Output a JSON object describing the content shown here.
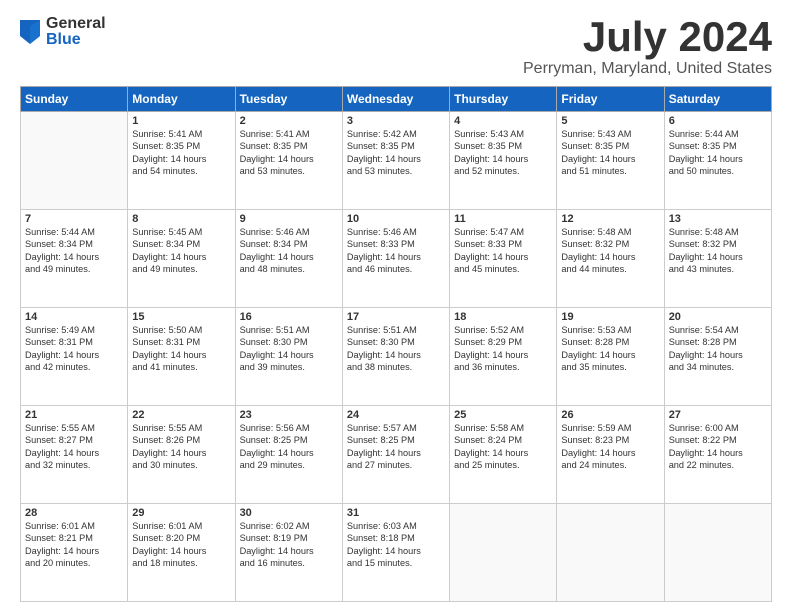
{
  "logo": {
    "general": "General",
    "blue": "Blue"
  },
  "title": "July 2024",
  "subtitle": "Perryman, Maryland, United States",
  "headers": [
    "Sunday",
    "Monday",
    "Tuesday",
    "Wednesday",
    "Thursday",
    "Friday",
    "Saturday"
  ],
  "weeks": [
    [
      {
        "day": "",
        "info": ""
      },
      {
        "day": "1",
        "info": "Sunrise: 5:41 AM\nSunset: 8:35 PM\nDaylight: 14 hours\nand 54 minutes."
      },
      {
        "day": "2",
        "info": "Sunrise: 5:41 AM\nSunset: 8:35 PM\nDaylight: 14 hours\nand 53 minutes."
      },
      {
        "day": "3",
        "info": "Sunrise: 5:42 AM\nSunset: 8:35 PM\nDaylight: 14 hours\nand 53 minutes."
      },
      {
        "day": "4",
        "info": "Sunrise: 5:43 AM\nSunset: 8:35 PM\nDaylight: 14 hours\nand 52 minutes."
      },
      {
        "day": "5",
        "info": "Sunrise: 5:43 AM\nSunset: 8:35 PM\nDaylight: 14 hours\nand 51 minutes."
      },
      {
        "day": "6",
        "info": "Sunrise: 5:44 AM\nSunset: 8:35 PM\nDaylight: 14 hours\nand 50 minutes."
      }
    ],
    [
      {
        "day": "7",
        "info": "Sunrise: 5:44 AM\nSunset: 8:34 PM\nDaylight: 14 hours\nand 49 minutes."
      },
      {
        "day": "8",
        "info": "Sunrise: 5:45 AM\nSunset: 8:34 PM\nDaylight: 14 hours\nand 49 minutes."
      },
      {
        "day": "9",
        "info": "Sunrise: 5:46 AM\nSunset: 8:34 PM\nDaylight: 14 hours\nand 48 minutes."
      },
      {
        "day": "10",
        "info": "Sunrise: 5:46 AM\nSunset: 8:33 PM\nDaylight: 14 hours\nand 46 minutes."
      },
      {
        "day": "11",
        "info": "Sunrise: 5:47 AM\nSunset: 8:33 PM\nDaylight: 14 hours\nand 45 minutes."
      },
      {
        "day": "12",
        "info": "Sunrise: 5:48 AM\nSunset: 8:32 PM\nDaylight: 14 hours\nand 44 minutes."
      },
      {
        "day": "13",
        "info": "Sunrise: 5:48 AM\nSunset: 8:32 PM\nDaylight: 14 hours\nand 43 minutes."
      }
    ],
    [
      {
        "day": "14",
        "info": "Sunrise: 5:49 AM\nSunset: 8:31 PM\nDaylight: 14 hours\nand 42 minutes."
      },
      {
        "day": "15",
        "info": "Sunrise: 5:50 AM\nSunset: 8:31 PM\nDaylight: 14 hours\nand 41 minutes."
      },
      {
        "day": "16",
        "info": "Sunrise: 5:51 AM\nSunset: 8:30 PM\nDaylight: 14 hours\nand 39 minutes."
      },
      {
        "day": "17",
        "info": "Sunrise: 5:51 AM\nSunset: 8:30 PM\nDaylight: 14 hours\nand 38 minutes."
      },
      {
        "day": "18",
        "info": "Sunrise: 5:52 AM\nSunset: 8:29 PM\nDaylight: 14 hours\nand 36 minutes."
      },
      {
        "day": "19",
        "info": "Sunrise: 5:53 AM\nSunset: 8:28 PM\nDaylight: 14 hours\nand 35 minutes."
      },
      {
        "day": "20",
        "info": "Sunrise: 5:54 AM\nSunset: 8:28 PM\nDaylight: 14 hours\nand 34 minutes."
      }
    ],
    [
      {
        "day": "21",
        "info": "Sunrise: 5:55 AM\nSunset: 8:27 PM\nDaylight: 14 hours\nand 32 minutes."
      },
      {
        "day": "22",
        "info": "Sunrise: 5:55 AM\nSunset: 8:26 PM\nDaylight: 14 hours\nand 30 minutes."
      },
      {
        "day": "23",
        "info": "Sunrise: 5:56 AM\nSunset: 8:25 PM\nDaylight: 14 hours\nand 29 minutes."
      },
      {
        "day": "24",
        "info": "Sunrise: 5:57 AM\nSunset: 8:25 PM\nDaylight: 14 hours\nand 27 minutes."
      },
      {
        "day": "25",
        "info": "Sunrise: 5:58 AM\nSunset: 8:24 PM\nDaylight: 14 hours\nand 25 minutes."
      },
      {
        "day": "26",
        "info": "Sunrise: 5:59 AM\nSunset: 8:23 PM\nDaylight: 14 hours\nand 24 minutes."
      },
      {
        "day": "27",
        "info": "Sunrise: 6:00 AM\nSunset: 8:22 PM\nDaylight: 14 hours\nand 22 minutes."
      }
    ],
    [
      {
        "day": "28",
        "info": "Sunrise: 6:01 AM\nSunset: 8:21 PM\nDaylight: 14 hours\nand 20 minutes."
      },
      {
        "day": "29",
        "info": "Sunrise: 6:01 AM\nSunset: 8:20 PM\nDaylight: 14 hours\nand 18 minutes."
      },
      {
        "day": "30",
        "info": "Sunrise: 6:02 AM\nSunset: 8:19 PM\nDaylight: 14 hours\nand 16 minutes."
      },
      {
        "day": "31",
        "info": "Sunrise: 6:03 AM\nSunset: 8:18 PM\nDaylight: 14 hours\nand 15 minutes."
      },
      {
        "day": "",
        "info": ""
      },
      {
        "day": "",
        "info": ""
      },
      {
        "day": "",
        "info": ""
      }
    ]
  ]
}
